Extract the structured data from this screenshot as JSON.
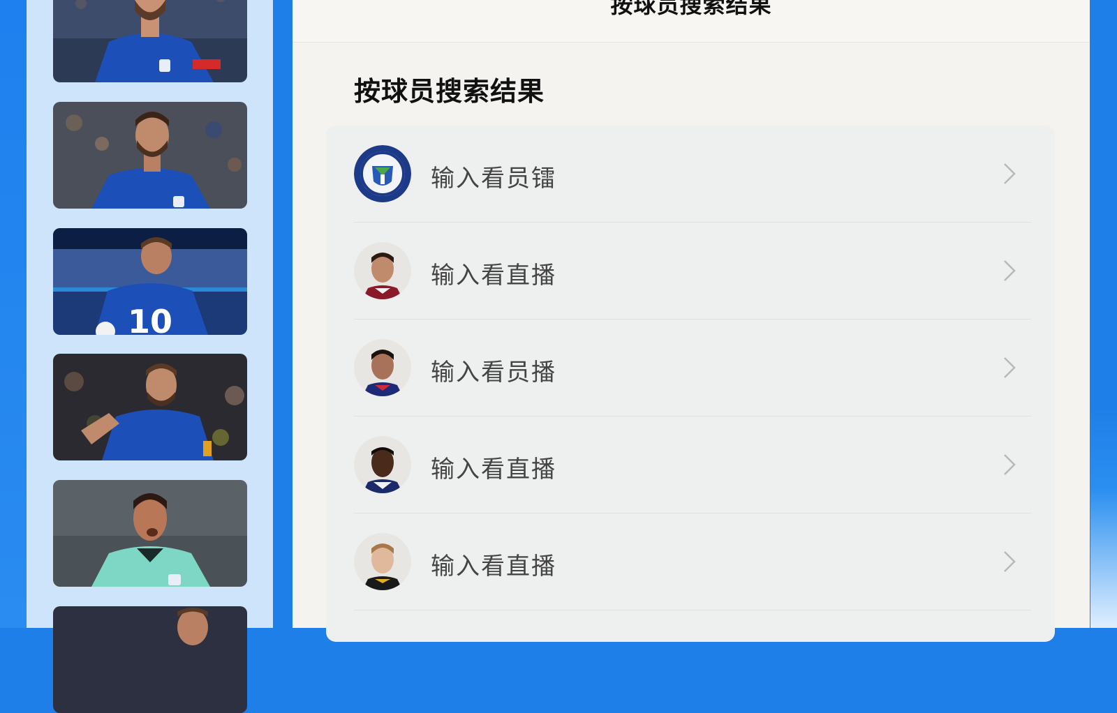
{
  "header": {
    "title": "按球员搜索结果"
  },
  "section": {
    "title": "按球员搜索结果"
  },
  "sidebar": {
    "thumbnails": [
      {
        "icon": "player-photo-blue-kit"
      },
      {
        "icon": "player-photo-blue-kit"
      },
      {
        "icon": "player-photo-number-10"
      },
      {
        "icon": "player-photo-blue-kit"
      },
      {
        "icon": "player-photo-green-kit"
      },
      {
        "icon": "player-photo-partial"
      }
    ]
  },
  "results": [
    {
      "label": "输入看员镭",
      "avatar": "club-crest-icon"
    },
    {
      "label": "输入看直播",
      "avatar": "player-avatar"
    },
    {
      "label": "输入看员播",
      "avatar": "player-avatar"
    },
    {
      "label": "输入看直播",
      "avatar": "player-avatar"
    },
    {
      "label": "输入看直播",
      "avatar": "player-avatar"
    }
  ],
  "colors": {
    "brand_blue": "#1f7fe8",
    "sidebar_bg": "#cde4fb",
    "panel_bg": "#f4f3f0",
    "jersey_blue": "#1d4fb8"
  }
}
